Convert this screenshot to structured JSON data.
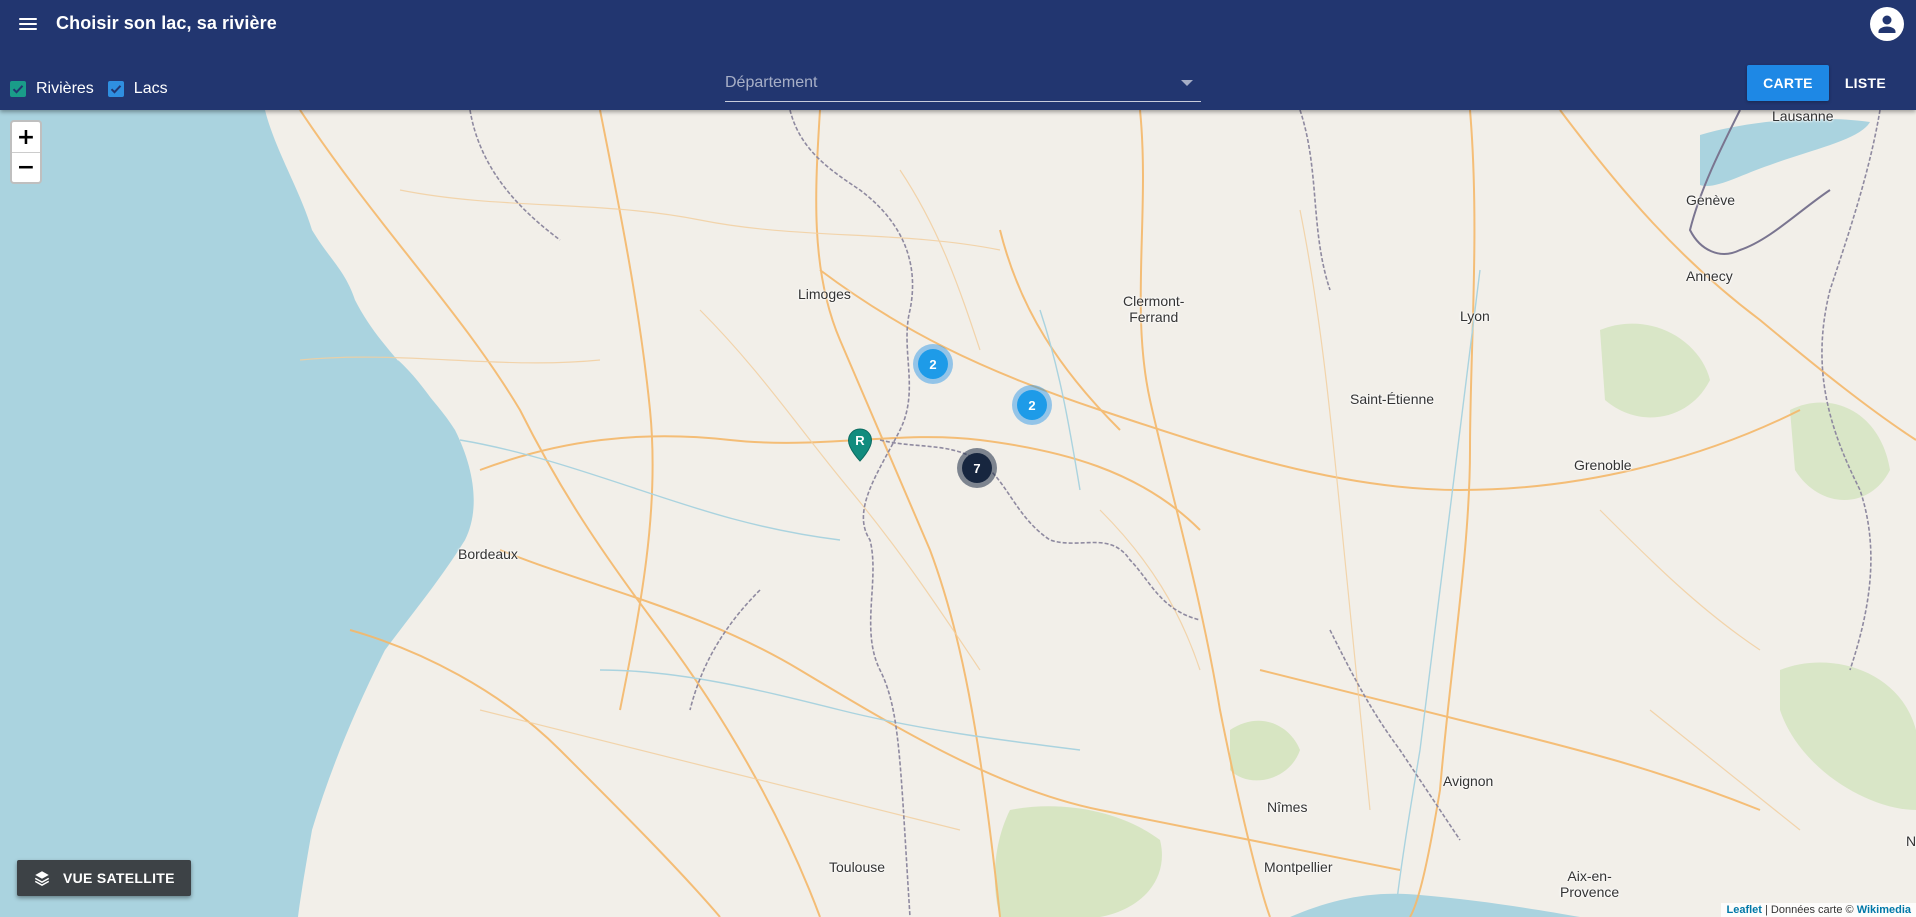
{
  "app": {
    "title": "Choisir son lac, sa rivière"
  },
  "filters": {
    "rivers_label": "Rivières",
    "lakes_label": "Lacs",
    "rivers_checked": true,
    "lakes_checked": true
  },
  "department_select": {
    "placeholder": "Département"
  },
  "view_toggle": {
    "map_label": "CARTE",
    "list_label": "LISTE",
    "active": "CARTE"
  },
  "map": {
    "zoom_in": "+",
    "zoom_out": "−",
    "cities": [
      "Lausanne",
      "Genève",
      "Annecy",
      "Limoges",
      "Clermont-\nFerrand",
      "Lyon",
      "Saint-Étienne",
      "Grenoble",
      "Bordeaux",
      "Avignon",
      "Nîmes",
      "Toulouse",
      "Montpellier",
      "Aix-en-\nProvence",
      "N"
    ],
    "clusters": [
      {
        "count": "2",
        "style": "light"
      },
      {
        "count": "2",
        "style": "light"
      },
      {
        "count": "7",
        "style": "dark"
      }
    ],
    "river_marker_letter": "R",
    "satellite_button": "VUE SATELLITE",
    "attribution": {
      "leaflet": "Leaflet",
      "text": " | Données carte © ",
      "provider": "Wikimedia"
    }
  }
}
